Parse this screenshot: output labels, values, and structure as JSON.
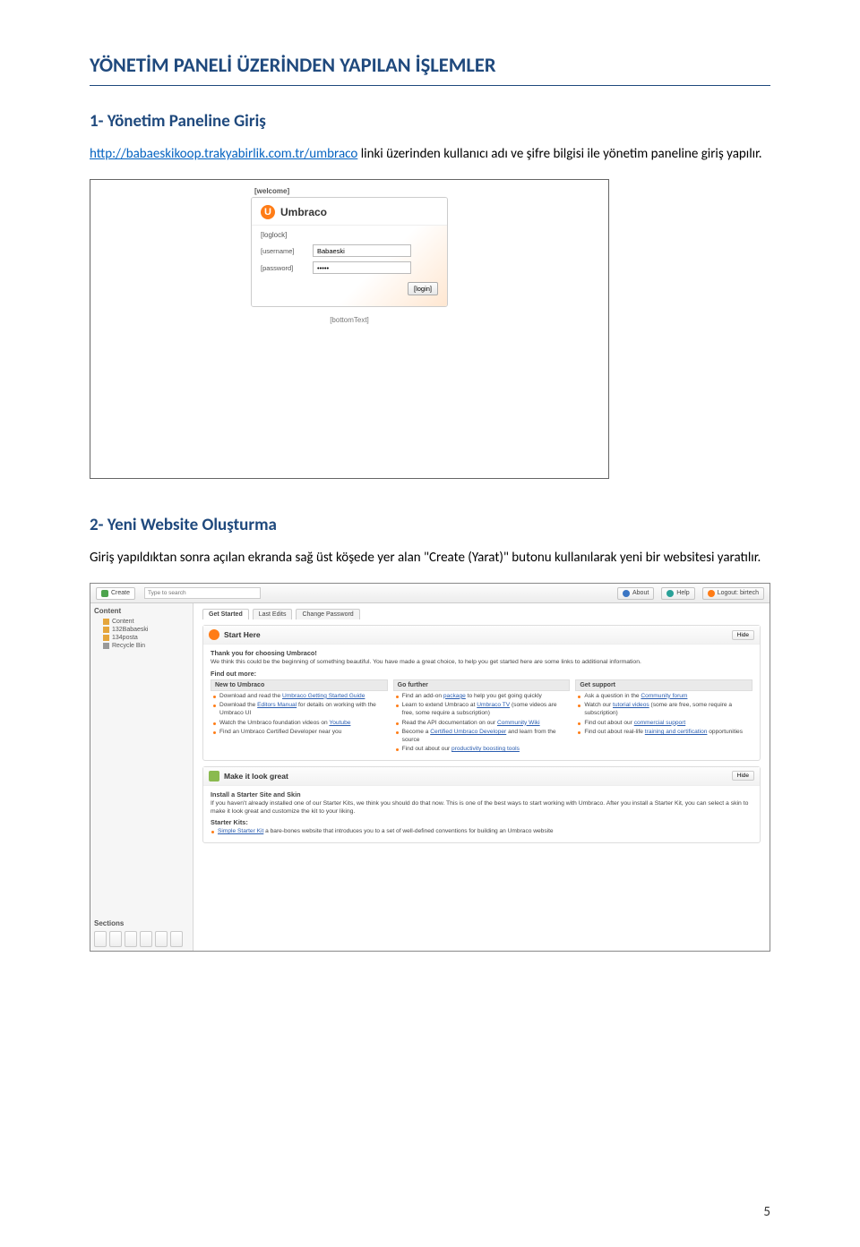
{
  "doc": {
    "title": "YÖNETİM PANELİ ÜZERİNDEN YAPILAN İŞLEMLER",
    "section1_h": "1- Yönetim Paneline Giriş",
    "section1_link": "http://babaeskikoop.trakyabirlik.com.tr/umbraco",
    "section1_rest": " linki üzerinden kullanıcı adı ve şifre bilgisi ile yönetim paneline giriş yapılır.",
    "section2_h": "2- Yeni Website Oluşturma",
    "section2_p": "Giriş yapıldıktan sonra açılan ekranda sağ üst köşede yer alan \"Create (Yarat)\" butonu kullanılarak yeni bir websitesi yaratılır.",
    "page_number": "5"
  },
  "login": {
    "welcome": "[welcome]",
    "brand": "Umbraco",
    "loglock": "[loglock]",
    "username_label": "[username]",
    "username_value": "Babaeski",
    "password_label": "[password]",
    "password_value": "•••••",
    "login_btn": "[login]",
    "bottom": "[bottomText]"
  },
  "dash": {
    "create": "Create",
    "search_placeholder": "Type to search",
    "about": "About",
    "help": "Help",
    "logout": "Logout: birtech",
    "side_h": "Content",
    "tree_root": "Content",
    "tree_items": [
      "132Babaeski",
      "134posta",
      "Recycle Bin"
    ],
    "sections_h": "Sections",
    "tabs": [
      "Get Started",
      "Last Edits",
      "Change Password"
    ],
    "panel1_title": "Start Here",
    "hide": "Hide",
    "thank": "Thank you for choosing Umbraco!",
    "thank_sub": "We think this could be the beginning of something beautiful. You have made a great choice, to help you get started here are some links to additional information.",
    "find_more": "Find out more:",
    "col1_h": "New to Umbraco",
    "col1": [
      "Download and read the <a>Umbraco Getting Started Guide</a>",
      "Download the <a>Editors Manual</a> for details on working with the Umbraco UI",
      "Watch the Umbraco foundation videos on <a>Youtube</a>",
      "Find an Umbraco Certified Developer near you"
    ],
    "col2_h": "Go further",
    "col2": [
      "Find an add-on <a>package</a> to help you get going quickly",
      "Learn to extend Umbraco at <a>Umbraco TV</a> (some videos are free, some require a subscription)",
      "Read the API documentation on our <a>Community Wiki</a>",
      "Become a <a>Certified Umbraco Developer</a> and learn from the source",
      "Find out about our <a>productivity boosting tools</a>"
    ],
    "col3_h": "Get support",
    "col3": [
      "Ask a question in the <a>Community forum</a>",
      "Watch our <a>tutorial videos</a> (some are free, some require a subscription)",
      "Find out about our <a>commercial support</a>",
      "Find out about real-life <a>training and certification</a> opportunities"
    ],
    "panel2_title": "Make it look great",
    "panel2_h": "Install a Starter Site and Skin",
    "panel2_txt": "If you haven't already installed one of our Starter Kits, we think you should do that now. This is one of the best ways to start working with Umbraco. After you install a Starter Kit, you can select a skin to make it look great and customize the kit to your liking.",
    "panel2_sk": "Starter Kits:",
    "panel2_li": "<a>Simple Starter Kit</a> a bare-bones website that introduces you to a set of well-defined conventions for building an Umbraco website"
  }
}
